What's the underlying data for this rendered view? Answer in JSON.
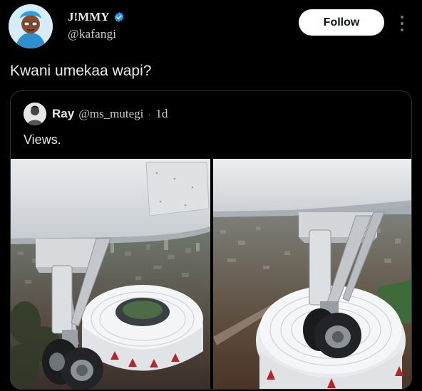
{
  "author": {
    "display_name": "J!MMY",
    "handle": "@kafangi",
    "verified": true
  },
  "follow_label": "Follow",
  "tweet_text": "Kwani umekaa wapi?",
  "quote": {
    "display_name": "Ray",
    "handle": "@ms_mutegi",
    "separator": "·",
    "time": "1d",
    "text": "Views."
  },
  "colors": {
    "background": "#000000",
    "follow_bg": "#ffffff",
    "verified": "#1d9bf0",
    "border": "#2f3336"
  },
  "icons": {
    "verified": "verified-badge-icon",
    "more": "more-vertical-icon"
  }
}
